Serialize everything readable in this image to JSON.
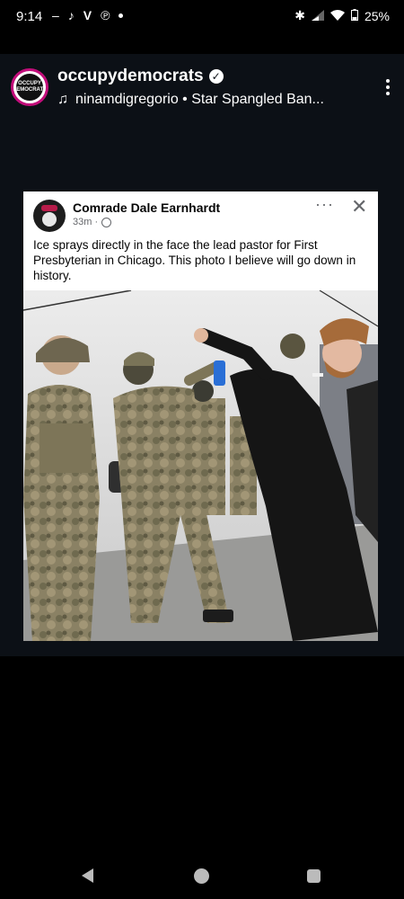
{
  "status_bar": {
    "time": "9:14",
    "battery": "25%",
    "left_icons": [
      "dash-icon",
      "tiktok-icon",
      "venmo-icon",
      "pinterest-icon",
      "dot-icon"
    ],
    "right_icons": [
      "bluetooth-icon",
      "signal-icon",
      "wifi-icon",
      "battery-icon"
    ]
  },
  "reel": {
    "account_name": "occupydemocrats",
    "verified": true,
    "avatar_text": "OCCUPY DEMOCRATS",
    "audio_icon": "music-note-icon",
    "audio_text": "ninamdigregorio • Star Spangled Ban..."
  },
  "post": {
    "author": "Comrade Dale Earnhardt",
    "time": "33m ·",
    "text": "Ice sprays directly in the face the lead pastor for First Presbyterian in Chicago. This photo I believe will go down in history.",
    "more_label": "···",
    "close_label": "✕"
  },
  "navigation": {
    "buttons": [
      "back",
      "home",
      "recents"
    ]
  },
  "colors": {
    "background": "#000000",
    "reel_background": "#0c1016",
    "avatar_ring": "#c20d7a",
    "post_text": "#050505",
    "post_meta": "#65676b"
  }
}
